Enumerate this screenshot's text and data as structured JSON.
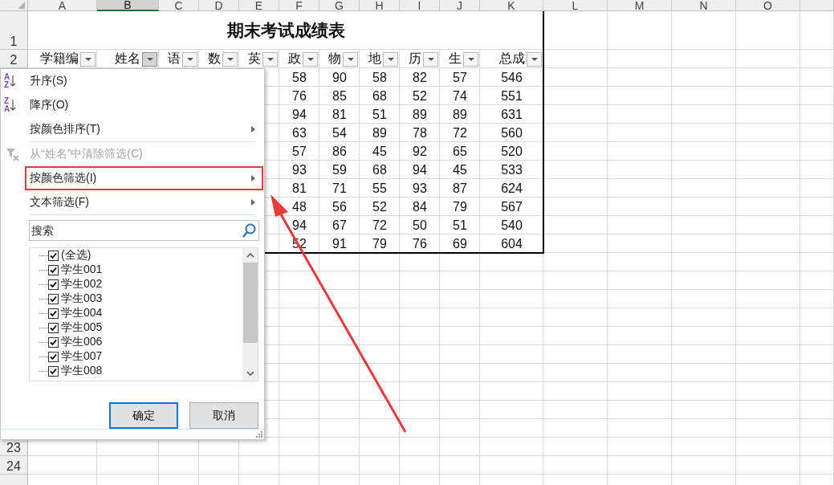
{
  "sheet": {
    "columns": [
      {
        "label": "A",
        "selected": false
      },
      {
        "label": "B",
        "selected": true
      },
      {
        "label": "C",
        "selected": false
      },
      {
        "label": "D",
        "selected": false
      },
      {
        "label": "E",
        "selected": false
      },
      {
        "label": "F",
        "selected": false
      },
      {
        "label": "G",
        "selected": false
      },
      {
        "label": "H",
        "selected": false
      },
      {
        "label": "I",
        "selected": false
      },
      {
        "label": "J",
        "selected": false
      },
      {
        "label": "K",
        "selected": false
      },
      {
        "label": "L",
        "selected": false
      },
      {
        "label": "M",
        "selected": false
      },
      {
        "label": "N",
        "selected": false
      },
      {
        "label": "O",
        "selected": false
      }
    ],
    "row_numbers": [
      "1",
      "2",
      "23",
      "24"
    ],
    "title": "期末考试成绩表",
    "headers": [
      {
        "label": "学籍编",
        "filter_open": false
      },
      {
        "label": "姓名",
        "filter_open": true
      },
      {
        "label": "语",
        "filter_open": false
      },
      {
        "label": "数",
        "filter_open": false
      },
      {
        "label": "英",
        "filter_open": false
      },
      {
        "label": "政",
        "filter_open": false
      },
      {
        "label": "物",
        "filter_open": false
      },
      {
        "label": "地",
        "filter_open": false
      },
      {
        "label": "历",
        "filter_open": false
      },
      {
        "label": "生",
        "filter_open": false
      },
      {
        "label": "总成",
        "filter_open": false
      }
    ],
    "rows": [
      [
        "",
        "",
        "",
        "",
        "",
        "58",
        "90",
        "58",
        "82",
        "57",
        "546"
      ],
      [
        "",
        "",
        "",
        "",
        "",
        "76",
        "85",
        "68",
        "52",
        "74",
        "551"
      ],
      [
        "",
        "",
        "",
        "",
        "",
        "94",
        "81",
        "51",
        "89",
        "89",
        "631"
      ],
      [
        "",
        "",
        "",
        "",
        "",
        "63",
        "54",
        "89",
        "78",
        "72",
        "560"
      ],
      [
        "",
        "",
        "",
        "",
        "",
        "57",
        "86",
        "45",
        "92",
        "65",
        "520"
      ],
      [
        "",
        "",
        "",
        "",
        "",
        "93",
        "59",
        "68",
        "94",
        "45",
        "533"
      ],
      [
        "",
        "",
        "",
        "",
        "",
        "81",
        "71",
        "55",
        "93",
        "87",
        "624"
      ],
      [
        "",
        "",
        "",
        "",
        "",
        "48",
        "56",
        "52",
        "84",
        "79",
        "567"
      ],
      [
        "",
        "",
        "",
        "",
        "",
        "94",
        "67",
        "72",
        "50",
        "51",
        "540"
      ],
      [
        "",
        "",
        "",
        "",
        "",
        "52",
        "91",
        "79",
        "76",
        "69",
        "604"
      ]
    ]
  },
  "filter_menu": {
    "items": [
      {
        "kind": "sort",
        "label": "升序(S)",
        "icon_letters": [
          "A",
          "Z"
        ],
        "submenu": false,
        "disabled": false,
        "highlighted": false
      },
      {
        "kind": "sort",
        "label": "降序(O)",
        "icon_letters": [
          "Z",
          "A"
        ],
        "submenu": false,
        "disabled": false,
        "highlighted": false
      },
      {
        "kind": "item",
        "label": "按颜色排序(T)",
        "submenu": true,
        "disabled": false,
        "highlighted": false
      },
      {
        "kind": "separator"
      },
      {
        "kind": "clear",
        "label": "从“姓名”中清除筛选(C)",
        "submenu": false,
        "disabled": true,
        "highlighted": false
      },
      {
        "kind": "item",
        "label": "按颜色筛选(I)",
        "submenu": true,
        "disabled": false,
        "highlighted": true
      },
      {
        "kind": "item",
        "label": "文本筛选(F)",
        "submenu": true,
        "disabled": false,
        "highlighted": false
      },
      {
        "kind": "separator"
      }
    ],
    "search": {
      "placeholder": "搜索"
    },
    "values": [
      {
        "label": "(全选)",
        "checked": true
      },
      {
        "label": "学生001",
        "checked": true
      },
      {
        "label": "学生002",
        "checked": true
      },
      {
        "label": "学生003",
        "checked": true
      },
      {
        "label": "学生004",
        "checked": true
      },
      {
        "label": "学生005",
        "checked": true
      },
      {
        "label": "学生006",
        "checked": true
      },
      {
        "label": "学生007",
        "checked": true
      },
      {
        "label": "学生008",
        "checked": true
      }
    ],
    "buttons": [
      {
        "label": "确定",
        "default": true
      },
      {
        "label": "取消",
        "default": false
      }
    ]
  },
  "annotation_arrow": true
}
